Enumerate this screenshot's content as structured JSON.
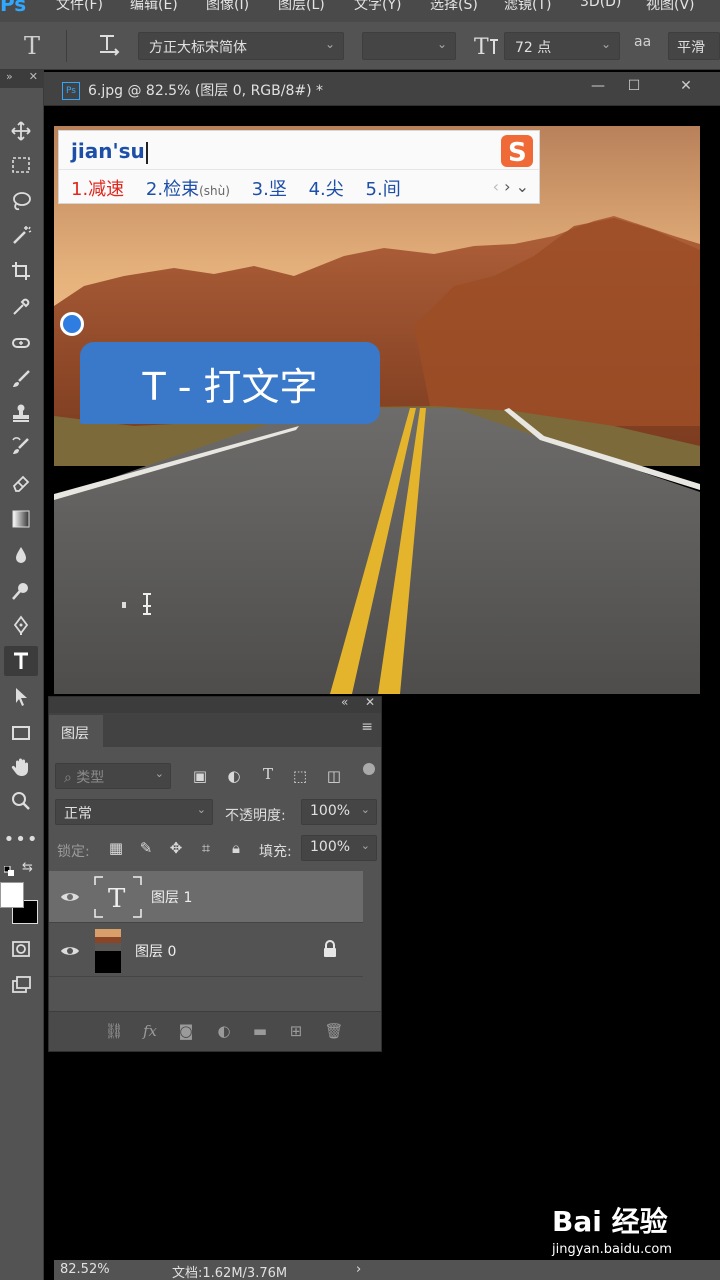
{
  "app": {
    "logo": "Ps"
  },
  "menu": [
    "文件(F)",
    "编辑(E)",
    "图像(I)",
    "图层(L)",
    "文字(Y)",
    "选择(S)",
    "滤镜(T)",
    "3D(D)",
    "视图(V)"
  ],
  "options": {
    "font_family": "方正大标宋简体",
    "font_size": "72 点",
    "aa_label": "aa",
    "aa_mode": "平滑"
  },
  "document": {
    "tab_title": "6.jpg @ 82.5% (图层 0, RGB/8#) *",
    "ps_badge": "Ps"
  },
  "ime": {
    "composition": "jian'su",
    "candidates": [
      "1.减速",
      "2.检束",
      "3.坚",
      "4.尖",
      "5.间"
    ],
    "candidate_2_hint": "(shù)"
  },
  "annotation": {
    "label": "T - 打文字"
  },
  "layers_panel": {
    "tab": "图层",
    "filter_placeholder": "类型",
    "blend_mode": "正常",
    "opacity_label": "不透明度:",
    "opacity_value": "100%",
    "lock_label": "锁定:",
    "fill_label": "填充:",
    "fill_value": "100%",
    "layers": [
      {
        "name": "图层 1",
        "type": "text",
        "selected": true
      },
      {
        "name": "图层 0",
        "type": "image",
        "locked": true
      }
    ]
  },
  "status": {
    "zoom": "82.52%",
    "doc_info": "文档:1.62M/3.76M",
    "arrow": "›"
  },
  "watermark": {
    "brand": "Bai 经验",
    "url": "jingyan.baidu.com"
  },
  "colors": {
    "accent": "#3a78c9",
    "ui_bg": "#535353",
    "ime_red": "#e0281f",
    "ime_blue": "#1d4fa8"
  }
}
